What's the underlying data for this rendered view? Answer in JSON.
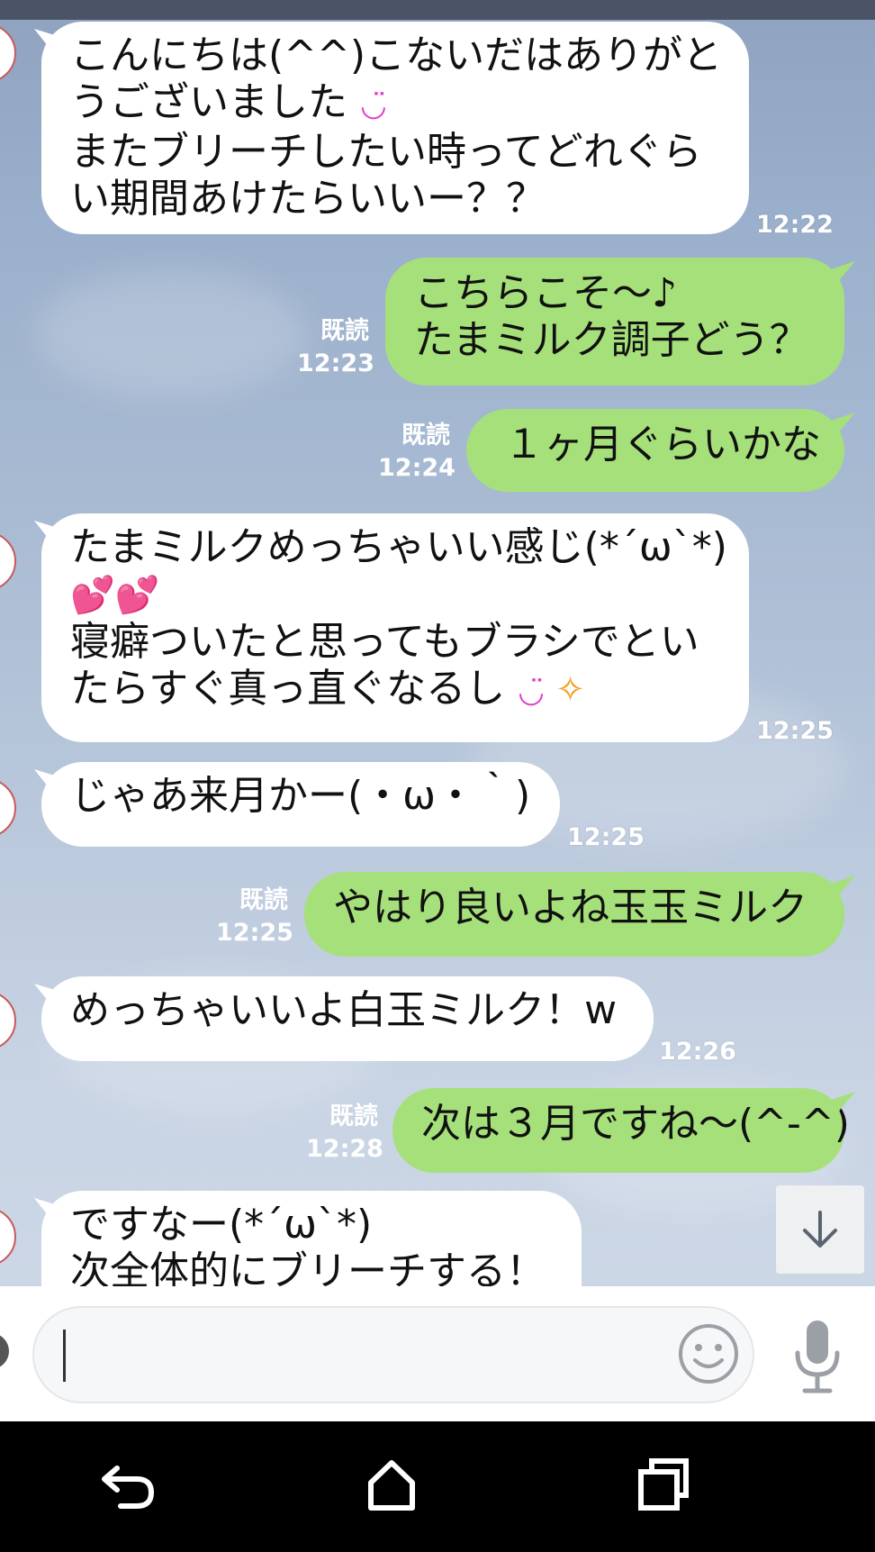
{
  "messages": [
    {
      "side": "left",
      "lines": [
        "こんにちは(^^)こないだはありがと",
        "うございました",
        "またブリーチしたい時ってどれぐら",
        "い期間あけたらいいー？？"
      ],
      "emoji_line1": "◡̈",
      "time": "12:22"
    },
    {
      "side": "right",
      "lines": [
        "こちらこそ～♪",
        "たまミルク調子どう？"
      ],
      "read": "既読",
      "time": "12:23"
    },
    {
      "side": "right",
      "lines": [
        "１ヶ月ぐらいかな"
      ],
      "read": "既読",
      "time": "12:24"
    },
    {
      "side": "left",
      "lines": [
        "たまミルクめっちゃいい感じ(*´ω`*)",
        "寝癖ついたと思ってもブラシでとい",
        "たらすぐ真っ直ぐなるし"
      ],
      "hearts": "💕💕",
      "smile": "◡̈",
      "sparkle": "✧",
      "time": "12:25"
    },
    {
      "side": "left",
      "lines": [
        "じゃあ来月かー(・ω・｀)"
      ],
      "time": "12:25"
    },
    {
      "side": "right",
      "lines": [
        "やはり良いよね玉玉ミルク"
      ],
      "read": "既読",
      "time": "12:25"
    },
    {
      "side": "left",
      "lines": [
        "めっちゃいいよ白玉ミルク！w"
      ],
      "time": "12:26"
    },
    {
      "side": "right",
      "lines": [
        "次は３月ですね～(^-^)"
      ],
      "read": "既読",
      "time": "12:28"
    },
    {
      "side": "left",
      "lines": [
        "ですなー(*´ω`*)",
        "次全体的にブリーチする！"
      ]
    }
  ],
  "icons": {
    "scroll_down": "arrow-down-icon",
    "emoji": "smiley-icon",
    "mic": "microphone-icon",
    "back": "back-icon",
    "home": "home-icon",
    "recents": "recents-icon"
  },
  "colors": {
    "left_bubble": "#ffffff",
    "right_bubble": "#a6e07a",
    "timestamp": "#ffffff",
    "input_bg": "#f6f7f8",
    "nav_bg": "#000000"
  }
}
